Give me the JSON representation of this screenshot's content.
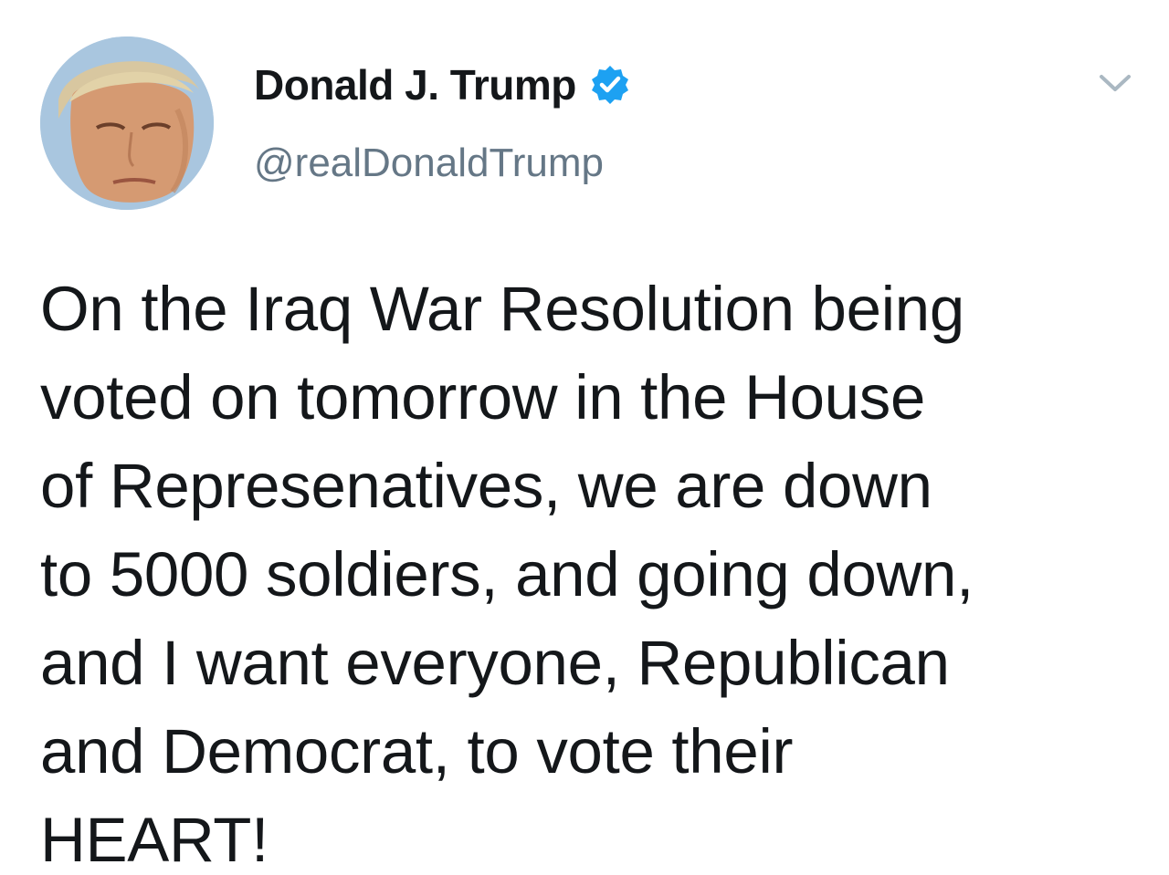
{
  "tweet": {
    "author": {
      "display_name": "Donald J. Trump",
      "handle": "@realDonaldTrump",
      "verified": true,
      "avatar_icon": "profile-photo",
      "verified_icon": "verified-badge-icon",
      "menu_icon": "chevron-down-icon"
    },
    "text_lines": [
      "On the Iraq War Resolution being",
      "voted on tomorrow in the House",
      "of Represenatives, we are down",
      "to 5000 soldiers, and going down,",
      "and I want everyone, Republican",
      "and Democrat, to vote their",
      "HEART!"
    ]
  },
  "colors": {
    "name": "#14171a",
    "handle": "#657786",
    "verified": "#1da1f2",
    "caret": "#aab8c2",
    "text": "#14171a"
  }
}
